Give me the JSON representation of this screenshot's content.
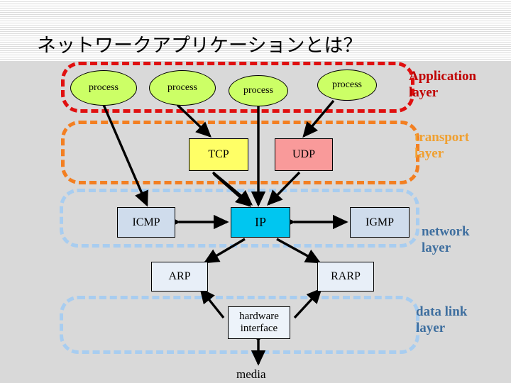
{
  "slide": {
    "title": "ネットワークアプリケーションとは？"
  },
  "layers": [
    {
      "id": "application",
      "label": "Application\nlayer",
      "color": "#c00000"
    },
    {
      "id": "transport",
      "label": "transport\nlayer",
      "color": "#f0a030"
    },
    {
      "id": "network",
      "label": "network\n layer",
      "color": "#3f6f9f"
    },
    {
      "id": "datalink",
      "label": "data link\nlayer",
      "color": "#3f6f9f"
    }
  ],
  "nodes": {
    "process_1": "process",
    "process_2": "process",
    "process_3": "process",
    "process_4": "process",
    "tcp": "TCP",
    "udp": "UDP",
    "icmp": "ICMP",
    "ip": "IP",
    "igmp": "IGMP",
    "arp": "ARP",
    "rarp": "RARP",
    "hardware_interface": "hardware\ninterface",
    "media": "media"
  },
  "colors": {
    "process_fill": "#ccff66",
    "tcp_fill": "#ffff66",
    "udp_fill": "#f99a9a",
    "ip_fill": "#00c6f0",
    "icmp_fill": "#cfdcec",
    "igmp_fill": "#cfdcec",
    "arp_fill": "#e8eff8",
    "rarp_fill": "#e8eff8",
    "hardware_fill": "#edf3fa",
    "application_border": "#e01010",
    "transport_border": "#f37f21",
    "network_border": "#a8cdf0",
    "datalink_border": "#a8cdf0",
    "background": "#d9d9d9",
    "arrow": "#000000"
  }
}
